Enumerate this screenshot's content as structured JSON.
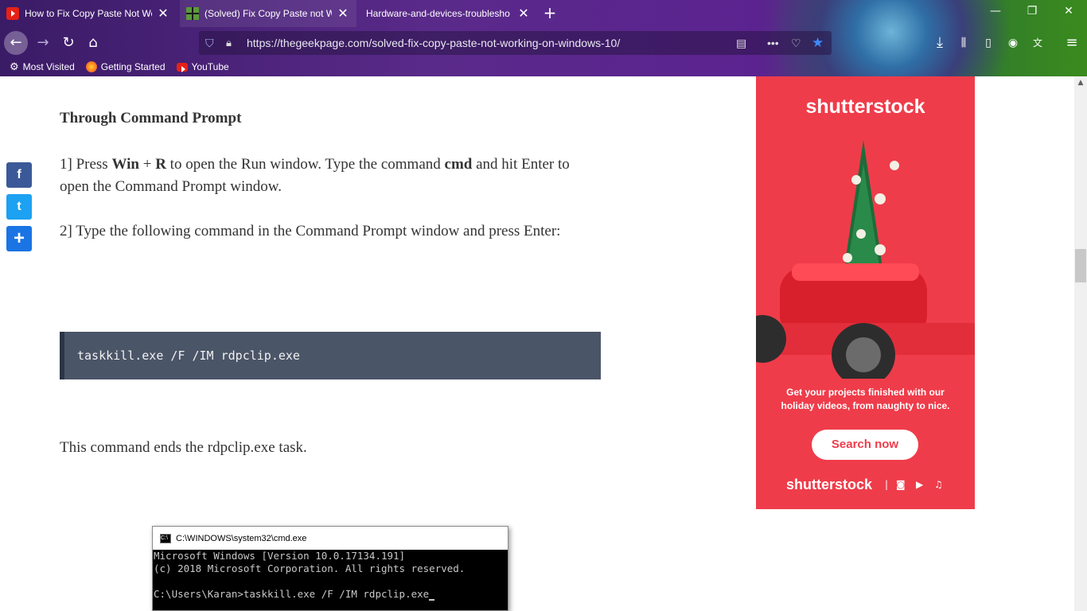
{
  "browser": {
    "tabs": [
      {
        "title": "How to Fix Copy Paste Not Wo",
        "favicon": "youtube-icon",
        "close": "✕"
      },
      {
        "title": "(Solved) Fix Copy Paste not Wo",
        "favicon": "geekpage-icon",
        "close": "✕"
      },
      {
        "title": "Hardware-and-devices-troublesho",
        "favicon": "",
        "close": "✕"
      }
    ],
    "new_tab": "+",
    "window_controls": {
      "minimize": "—",
      "restore": "❐",
      "close": "✕"
    },
    "url": "https://thegeekpage.com/solved-fix-copy-paste-not-working-on-windows-10/",
    "bookmarks": [
      {
        "label": "Most Visited",
        "icon": "gear-icon"
      },
      {
        "label": "Getting Started",
        "icon": "firefox-icon"
      },
      {
        "label": "YouTube",
        "icon": "youtube-icon"
      }
    ]
  },
  "article": {
    "heading": "Through Command Prompt",
    "step1": {
      "prefix": "1] Press ",
      "key1": "Win",
      "plus": " + ",
      "key2": "R",
      "mid": " to open the Run window. Type the command ",
      "cmd": "cmd",
      "suffix": " and hit Enter to open the Command Prompt window."
    },
    "step2": "2] Type the following command in the Command Prompt window and press Enter:",
    "code": "taskkill.exe /F /IM rdpclip.exe",
    "result": "This command ends the rdpclip.exe task."
  },
  "share": {
    "facebook": "f",
    "twitter": "t",
    "more": "+"
  },
  "ad": {
    "brand": "shutterstock",
    "text": "Get your projects finished with our holiday videos, from naughty to nice.",
    "button": "Search now",
    "brand_footer": "shutterstock",
    "accent": "#ef3c4a"
  },
  "cmd_window": {
    "title": "C:\\WINDOWS\\system32\\cmd.exe",
    "lines": [
      "Microsoft Windows [Version 10.0.17134.191]",
      "(c) 2018 Microsoft Corporation. All rights reserved.",
      "",
      "C:\\Users\\Karan>taskkill.exe /F /IM rdpclip.exe"
    ]
  }
}
